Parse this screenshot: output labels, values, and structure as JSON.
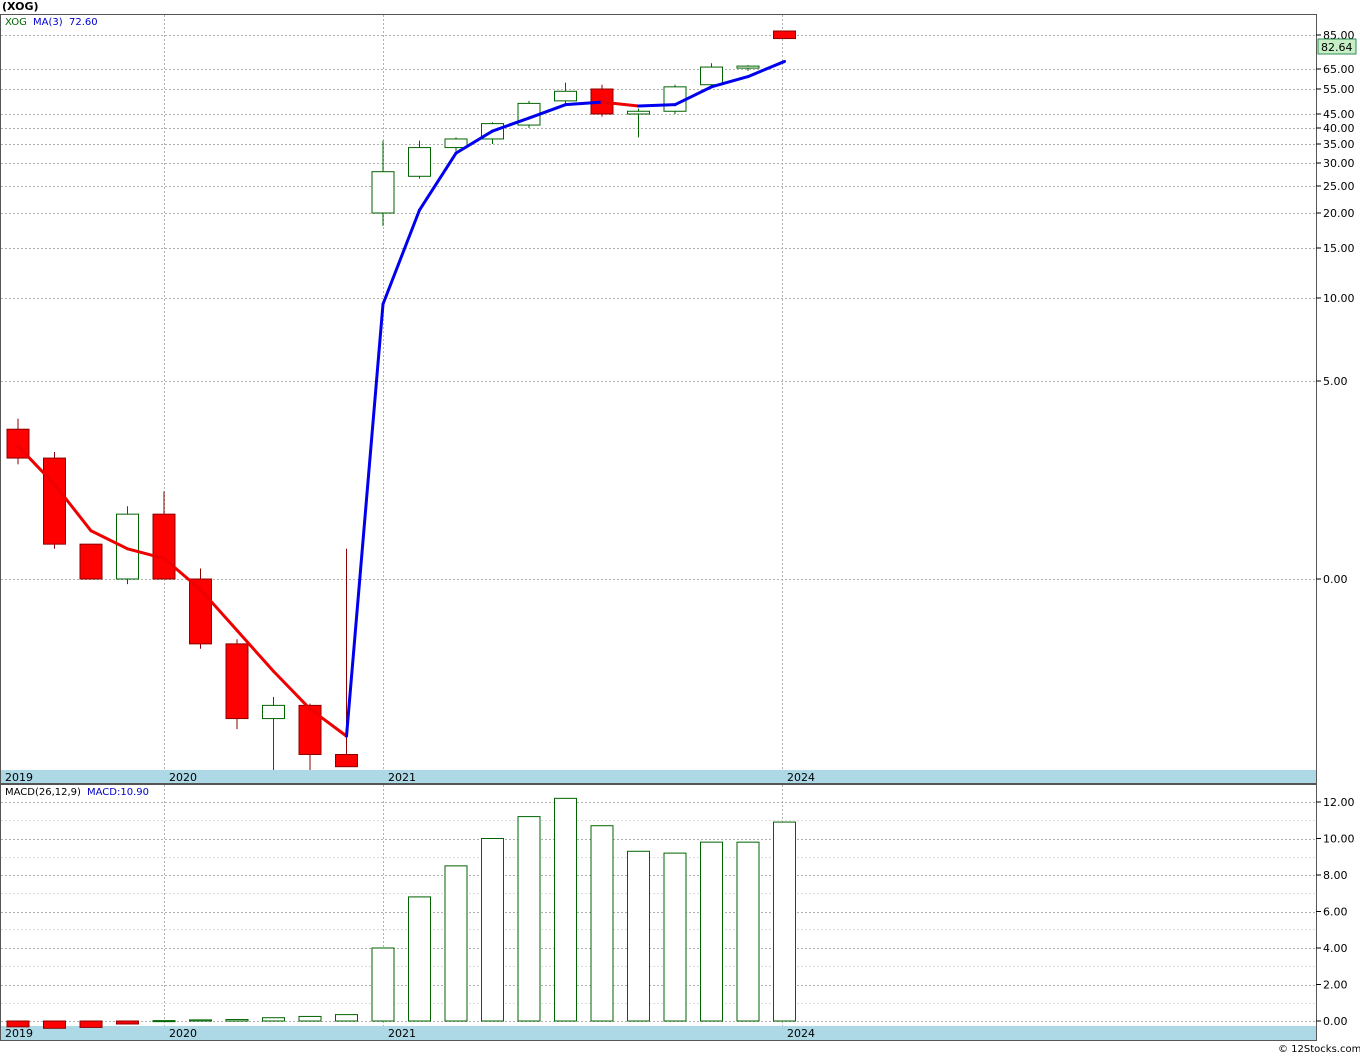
{
  "title": "(XOG)",
  "footer": "© 12Stocks.com",
  "colors": {
    "up_stroke": "#006400",
    "down_fill": "#ff0000",
    "ma_up": "#0000ee",
    "ma_down": "#ee0000",
    "axis_band": "#add8e6",
    "grid": "#b0b0b0",
    "last_price_bg": "#c6efc6"
  },
  "chart_data": [
    {
      "type": "candlestick",
      "legend": {
        "ticker": "XOG",
        "ma_label": "MA(3)",
        "ma_value": "72.60"
      },
      "last_price_label": "82.64",
      "y_tick_labels": [
        "85.00",
        "65.00",
        "55.00",
        "45.00",
        "40.00",
        "35.00",
        "30.00",
        "25.00",
        "20.00",
        "15.00",
        "10.00",
        "5.00",
        "0.00"
      ],
      "x_tick_labels": [
        "2019",
        "2020",
        "2021",
        "2024"
      ],
      "candles": [
        {
          "o": 4.0,
          "h": 4.2,
          "l": 3.4,
          "c": 3.5
        },
        {
          "o": 3.5,
          "h": 3.6,
          "l": 2.3,
          "c": 2.35
        },
        {
          "o": 2.35,
          "h": 2.35,
          "l": 2.0,
          "c": 2.0
        },
        {
          "o": 2.0,
          "h": 2.8,
          "l": 1.9,
          "c": 2.7
        },
        {
          "o": 2.7,
          "h": 3.0,
          "l": 2.0,
          "c": 2.0
        },
        {
          "o": 2.0,
          "h": 2.1,
          "l": 1.0,
          "c": 1.05
        },
        {
          "o": 1.05,
          "h": 1.1,
          "l": 0.45,
          "c": 0.5
        },
        {
          "o": 0.5,
          "h": 0.62,
          "l": 0.3,
          "c": 0.57
        },
        {
          "o": 0.57,
          "h": 0.58,
          "l": 0.3,
          "c": 0.35
        },
        {
          "o": 0.35,
          "h": 2.3,
          "l": 0.31,
          "c": 0.31
        },
        {
          "o": 20.0,
          "h": 36.0,
          "l": 18.0,
          "c": 28.0
        },
        {
          "o": 27.0,
          "h": 36.0,
          "l": 26.5,
          "c": 34.0
        },
        {
          "o": 34.0,
          "h": 37.0,
          "l": 33.0,
          "c": 36.5
        },
        {
          "o": 36.5,
          "h": 42.0,
          "l": 35.0,
          "c": 41.5
        },
        {
          "o": 41.0,
          "h": 50.0,
          "l": 40.0,
          "c": 49.0
        },
        {
          "o": 50.0,
          "h": 58.0,
          "l": 49.0,
          "c": 54.0
        },
        {
          "o": 55.0,
          "h": 57.0,
          "l": 44.0,
          "c": 45.0
        },
        {
          "o": 45.0,
          "h": 47.0,
          "l": 37.0,
          "c": 46.0
        },
        {
          "o": 46.0,
          "h": 57.0,
          "l": 45.0,
          "c": 56.0
        },
        {
          "o": 57.0,
          "h": 68.0,
          "l": 56.0,
          "c": 66.0
        },
        {
          "o": 66.0,
          "h": 67.0,
          "l": 64.0,
          "c": 66.5
        },
        {
          "o": 88.0,
          "h": 88.0,
          "l": 82.6,
          "c": 82.64
        }
      ],
      "ma": [
        3.7,
        3.1,
        2.5,
        2.3,
        2.2,
        1.8,
        1.2,
        0.8,
        0.55,
        0.42,
        9.5,
        20.5,
        32.5,
        39.0,
        43.5,
        48.5,
        49.5,
        48.0,
        48.5,
        56.0,
        61.0,
        69.0
      ]
    },
    {
      "type": "bar",
      "legend": {
        "label": "MACD(26,12,9)",
        "value_label": "MACD:10.90"
      },
      "y_tick_labels": [
        "12.00",
        "10.00",
        "8.00",
        "6.00",
        "4.00",
        "2.00",
        "0.00"
      ],
      "x_tick_labels": [
        "2019",
        "2020",
        "2021",
        "2024"
      ],
      "ylim": [
        0,
        12
      ],
      "values": [
        -0.2,
        -0.25,
        -0.22,
        -0.08,
        0.02,
        0.06,
        0.08,
        0.18,
        0.25,
        0.35,
        4.0,
        6.8,
        8.5,
        10.0,
        11.2,
        12.2,
        10.7,
        9.3,
        9.2,
        9.8,
        9.8,
        10.9
      ]
    }
  ]
}
